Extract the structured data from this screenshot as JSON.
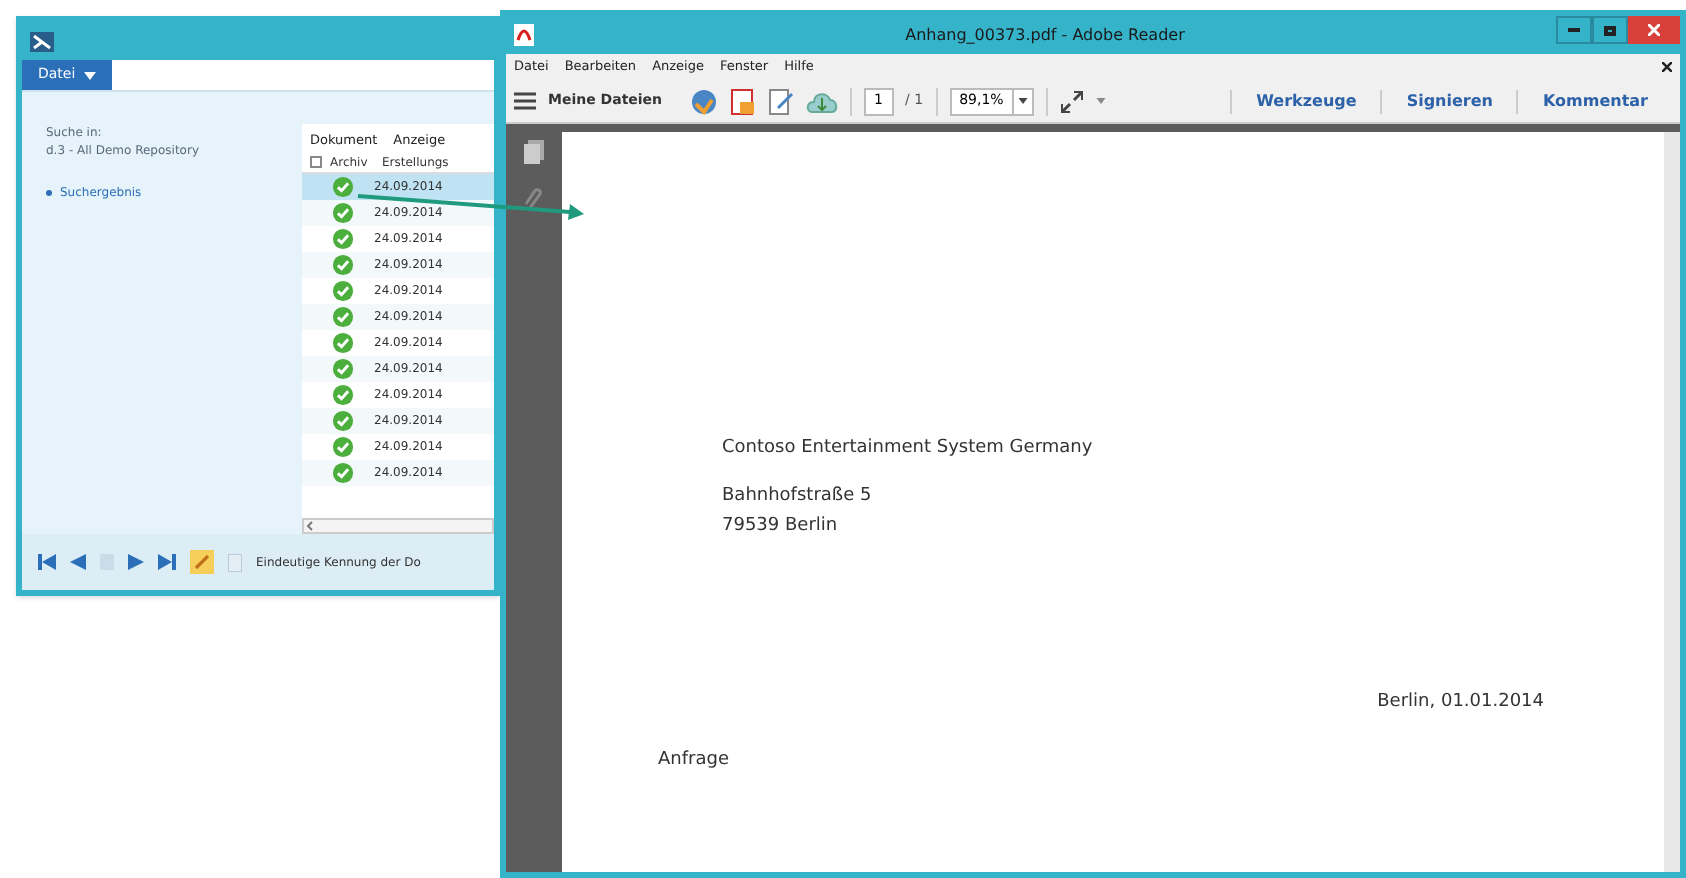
{
  "search_window": {
    "menu_button": "Datei",
    "search_in_label": "Suche in:",
    "repository": "d.3 - All Demo Repository",
    "tree": [
      {
        "label": "Suchergebnis",
        "selected": false
      }
    ],
    "toolbar_tabs": [
      "Dokument",
      "Anzeige"
    ],
    "select_all_checked": false,
    "columns": [
      "Archiv",
      "Erstellungs"
    ],
    "rows": [
      {
        "date": "24.09.2014",
        "selected": true
      },
      {
        "date": "24.09.2014",
        "selected": false
      },
      {
        "date": "24.09.2014",
        "selected": false
      },
      {
        "date": "24.09.2014",
        "selected": false
      },
      {
        "date": "24.09.2014",
        "selected": false
      },
      {
        "date": "24.09.2014",
        "selected": false
      },
      {
        "date": "24.09.2014",
        "selected": false
      },
      {
        "date": "24.09.2014",
        "selected": false
      },
      {
        "date": "24.09.2014",
        "selected": false
      },
      {
        "date": "24.09.2014",
        "selected": false
      },
      {
        "date": "24.09.2014",
        "selected": false
      },
      {
        "date": "24.09.2014",
        "selected": false
      }
    ],
    "status_text": "Eindeutige Kennung der Do"
  },
  "reader_window": {
    "title": "Anhang_00373.pdf - Adobe Reader",
    "menu": [
      "Datei",
      "Bearbeiten",
      "Anzeige",
      "Fenster",
      "Hilfe"
    ],
    "my_files": "Meine Dateien",
    "page": "1",
    "page_total": "/ 1",
    "zoom": "89,1%",
    "panels": [
      "Werkzeuge",
      "Signieren",
      "Kommentar"
    ],
    "document": {
      "recipient": "Contoso Entertainment System Germany",
      "street": "Bahnhofstraße 5",
      "city": "79539 Berlin",
      "date_line": "Berlin, 01.01.2014",
      "subject": "Anfrage"
    }
  }
}
